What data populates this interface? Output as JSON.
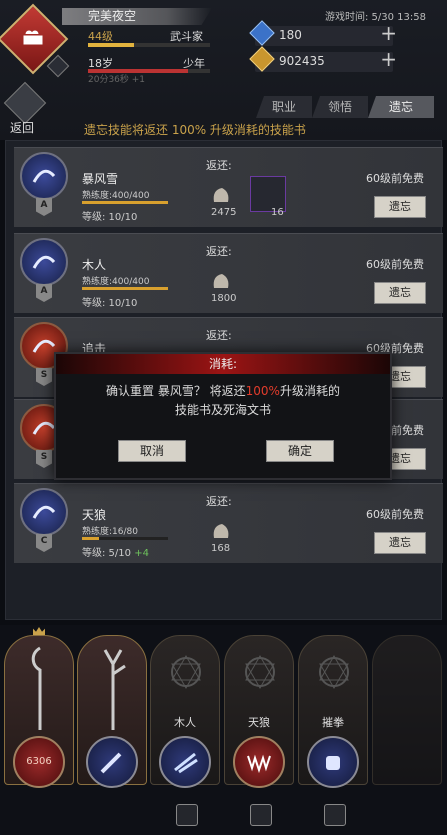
{
  "header": {
    "player_name": "完美夜空",
    "level": "44级",
    "class_name": "武斗家",
    "level_progress": 0.38,
    "age": "18岁",
    "age_stage": "少年",
    "age_progress": 0.82,
    "timer": "20分36秒 +1",
    "game_time": "游戏时间: 5/30 13:58",
    "diamonds": "180",
    "gold": "902435",
    "back_label": "返回"
  },
  "tabs": [
    {
      "label": "职业"
    },
    {
      "label": "领悟"
    },
    {
      "label": "遗忘",
      "active": true
    }
  ],
  "forget_notice": "遗忘技能将返还 100% 升级消耗的技能书",
  "skills": [
    {
      "name": "暴风雪",
      "grade": "A",
      "proficiency": "熟练度:400/400",
      "proficiency_progress": 1.0,
      "level": "等级: 10/10",
      "level_bonus": "",
      "return_label": "返还:",
      "item1_count": "2475",
      "item2_count": "16",
      "free_text": "60级前免费",
      "button": "遗忘",
      "icon": "blizzard-icon"
    },
    {
      "name": "木人",
      "grade": "A",
      "proficiency": "熟练度:400/400",
      "proficiency_progress": 1.0,
      "level": "等级: 10/10",
      "level_bonus": "",
      "return_label": "返还:",
      "item1_count": "1800",
      "item2_count": "",
      "free_text": "60级前免费",
      "button": "遗忘",
      "icon": "wooden-man-icon"
    },
    {
      "name": "追击",
      "grade": "S",
      "proficiency": "",
      "proficiency_progress": 0,
      "level": "",
      "level_bonus": "",
      "return_label": "返还:",
      "item1_count": "",
      "item2_count": "",
      "free_text": "60级前免费",
      "button": "遗忘",
      "icon": "pursuit-icon"
    },
    {
      "name": "",
      "grade": "S",
      "proficiency": "",
      "proficiency_progress": 0,
      "level": "",
      "level_bonus": "",
      "return_label": "",
      "item1_count": "",
      "item2_count": "",
      "free_text": "60级前免费",
      "button": "遗忘",
      "icon": "spiral-icon"
    },
    {
      "name": "天狼",
      "grade": "C",
      "proficiency": "熟练度:16/80",
      "proficiency_progress": 0.2,
      "level": "等级: 5/10 ",
      "level_bonus": "+4",
      "return_label": "返还:",
      "item1_count": "168",
      "item2_count": "",
      "free_text": "60级前免费",
      "button": "遗忘",
      "icon": "wolf-fang-icon"
    }
  ],
  "modal": {
    "title": "消耗:",
    "message_prefix": "确认重置 暴风雪？ 将返还",
    "message_highlight": "100%",
    "message_suffix": "升级消耗的",
    "message_line2": "技能书及死海文书",
    "cancel": "取消",
    "confirm": "确定"
  },
  "bottom": {
    "weapon_value": "6306",
    "skill_slots": [
      {
        "label": "木人"
      },
      {
        "label": "天狼"
      },
      {
        "label": "摧拳"
      }
    ]
  },
  "colors": {
    "gold_text": "#c9a24b",
    "highlight_red": "#e23c2c",
    "bonus_green": "#6ec25c"
  }
}
